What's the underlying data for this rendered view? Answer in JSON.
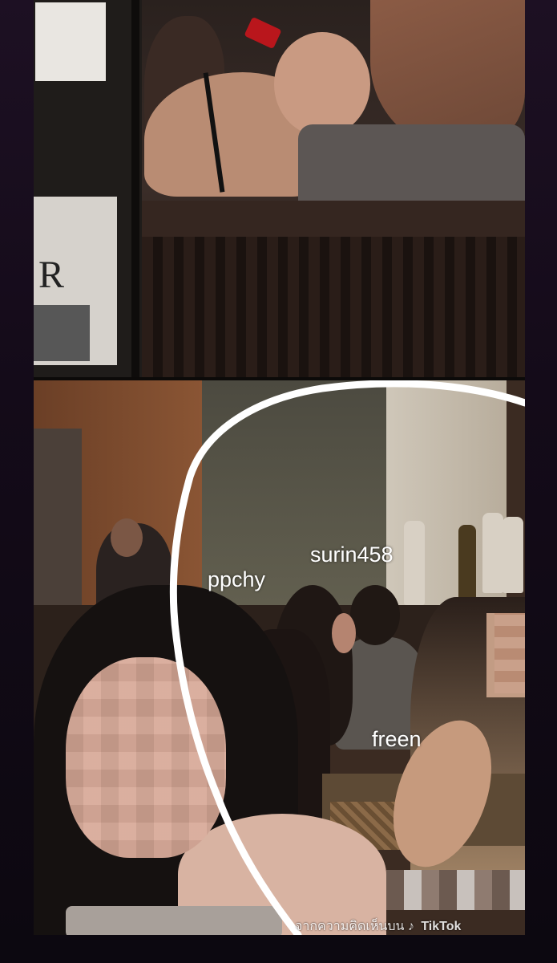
{
  "tags": {
    "ppchy": "ppchy",
    "surin458": "surin458",
    "freen": "freen"
  },
  "watermark": {
    "text": "จากความคิดเห็นบน",
    "icon": "tiktok-icon",
    "brand": "TikTok"
  },
  "colors": {
    "background": "#1a0f1f",
    "annotation_stroke": "#ffffff",
    "tag_text": "#ffffff"
  }
}
